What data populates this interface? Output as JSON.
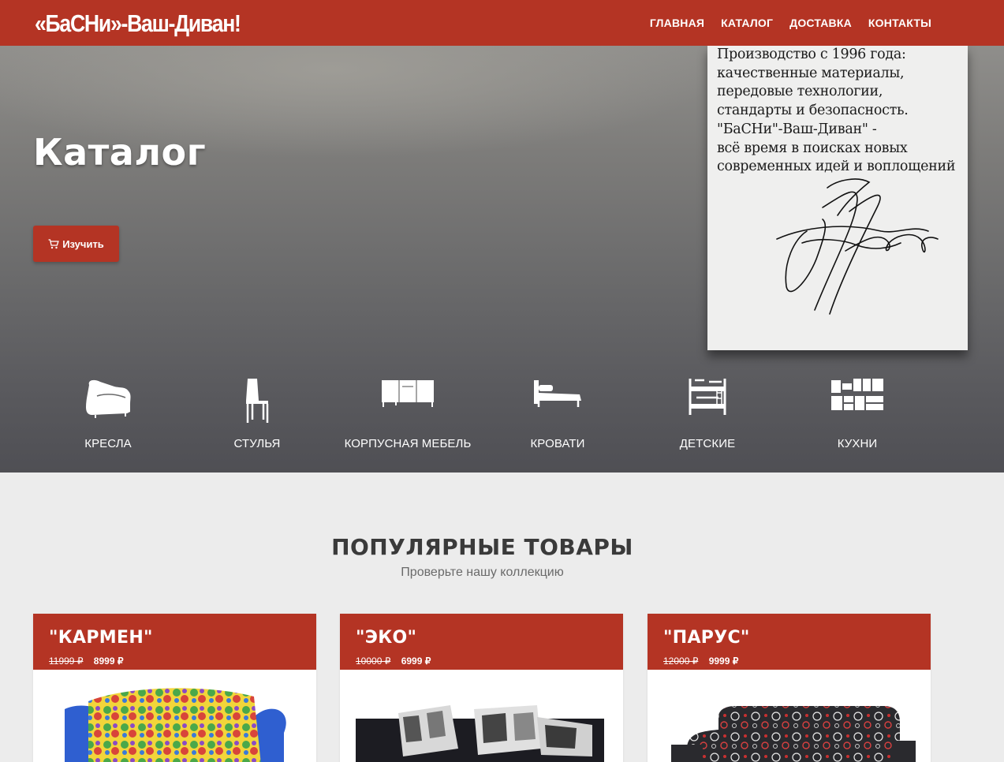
{
  "header": {
    "logo": "«БаСНи»-Ваш-Диван!",
    "nav": [
      "ГЛАВНАЯ",
      "КАТАЛОГ",
      "ДОСТАВКА",
      "КОНТАКТЫ"
    ]
  },
  "hero": {
    "title": "Каталог",
    "button_label": "Изучить",
    "button_icon": "cart-icon",
    "note_text": "Производство с 1996 года:\nкачественные материалы,\nпередовые технологии,\nстандарты и безопасность.\n\"БаСНи\"-Ваш-Диван\" -\nвсё время в поисках новых\nсовременных идей и воплощений"
  },
  "categories": [
    {
      "label": "КРЕСЛА",
      "icon": "armchair-icon"
    },
    {
      "label": "СТУЛЬЯ",
      "icon": "chair-icon"
    },
    {
      "label": "КОРПУСНАЯ МЕБЕЛЬ",
      "icon": "cabinet-icon"
    },
    {
      "label": "КРОВАТИ",
      "icon": "bed-icon"
    },
    {
      "label": "ДЕТСКИЕ",
      "icon": "bunk-bed-icon"
    },
    {
      "label": "КУХНИ",
      "icon": "kitchen-icon"
    }
  ],
  "popular": {
    "title": "ПОПУЛЯРНЫЕ ТОВАРЫ",
    "subtitle": "Проверьте нашу коллекцию",
    "products": [
      {
        "name": "\"КАРМЕН\"",
        "old_price": "11999 ₽",
        "price": "8999 ₽"
      },
      {
        "name": "\"ЭКО\"",
        "old_price": "10000 ₽",
        "price": "6999 ₽"
      },
      {
        "name": "\"ПАРУС\"",
        "old_price": "12000 ₽",
        "price": "9999 ₽"
      }
    ]
  },
  "colors": {
    "brand_red": "#b43424",
    "page_bg": "#ececec"
  }
}
